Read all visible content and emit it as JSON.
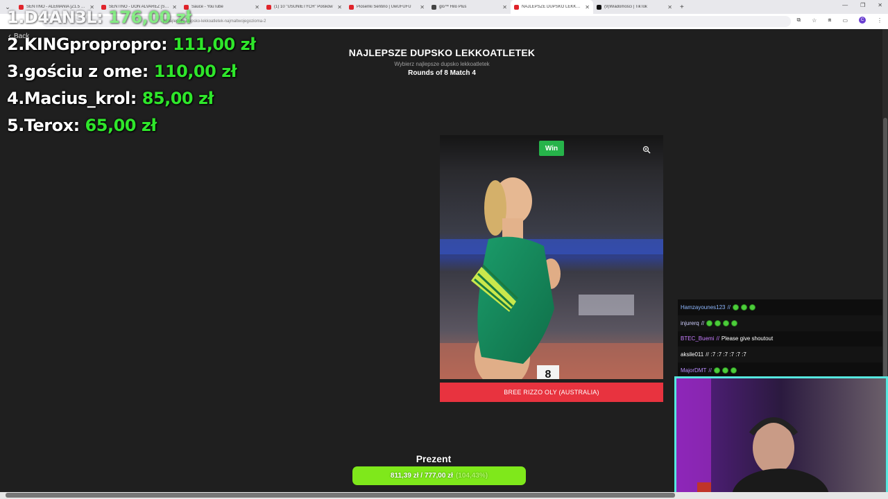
{
  "browser": {
    "tabs": [
      {
        "label": "SENTINO - ALEMANIA [Z1.5 SI...",
        "color": "#e0242b",
        "active": false
      },
      {
        "label": "SENTINO - DON ALVAREZ [SN...",
        "color": "#e0242b",
        "active": false
      },
      {
        "label": "Sauce - YouTube",
        "color": "#e0242b",
        "active": false
      },
      {
        "label": "(1) 10 \"USUNIETYCH\" Polsków",
        "color": "#e0242b",
        "active": false
      },
      {
        "label": "Piosenki Sentino | UwUFUFU",
        "color": "#e0242b",
        "active": false
      },
      {
        "label": "glo™ Hilo Plus",
        "color": "#444444",
        "active": false
      },
      {
        "label": "NAJLEPSZE DUPSKO LEKKOATL...",
        "color": "#e0242b",
        "active": true
      },
      {
        "label": "(9)Wiadomości | TikTok",
        "color": "#111111",
        "active": false
      }
    ],
    "new_tab": "+",
    "url": "...pl/najlepsze-dupsko-lekkoatletek-najmaltwojegozioma-2",
    "profile_initial": "C"
  },
  "page": {
    "back_label": "Back",
    "title": "NAJLEPSZE DUPSKO LEKKOATLETEK",
    "subtitle": "Wybierz najlepsze dupsko lekkoatletek",
    "rounds": "Rounds of 8 Match 4",
    "win_label": "Win",
    "contestant_name": "BREE RIZZO OLY (AUSTRALIA)"
  },
  "leaderboard": [
    {
      "rank": "1.D4AN3L:",
      "amount": "176,00 zł"
    },
    {
      "rank": "2.KINGpropropro:",
      "amount": "111,00 zł"
    },
    {
      "rank": "3.gościu z ome:",
      "amount": "110,00 zł"
    },
    {
      "rank": "4.Macius_krol:",
      "amount": "85,00 zł"
    },
    {
      "rank": "5.Terox:",
      "amount": "65,00 zł"
    }
  ],
  "chat": [
    {
      "user": "Hamzayounes123",
      "user_color": "#8fb8ff",
      "sep": "//",
      "msg": "",
      "emotes": 3
    },
    {
      "user": "injurerq",
      "user_color": "#cfcfff",
      "sep": "//",
      "msg": "",
      "emotes": 4
    },
    {
      "user": "BTEC_Buemi",
      "user_color": "#c77dff",
      "sep": "//",
      "msg": "Please give shoutout",
      "emotes": 0
    },
    {
      "user": "aksile011",
      "user_color": "#ffffff",
      "sep": "//",
      "msg": ":7 :7 :7 :7 :7 :7",
      "emotes": 0
    },
    {
      "user": "MajorDMT",
      "user_color": "#b98cff",
      "sep": "//",
      "msg": "",
      "emotes": 3
    }
  ],
  "goal": {
    "label": "Prezent",
    "text": "811,39 zł / 777,00 zł",
    "percent_text": "(104,43%)",
    "progress": 1.0443,
    "color": "#7fe81b"
  }
}
